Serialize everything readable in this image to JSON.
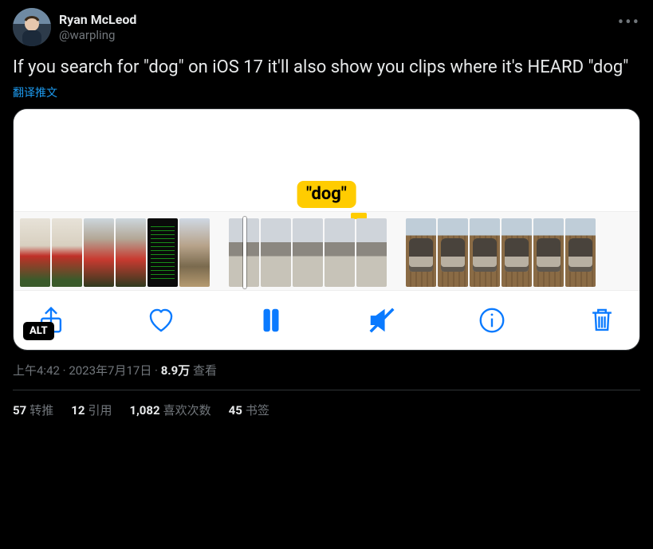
{
  "author": {
    "display_name": "Ryan McLeod",
    "handle": "@warpling"
  },
  "more_icon_label": "more",
  "tweet_text": "If you search for \"dog\" on iOS 17 it'll also show you clips where it's HEARD \"dog\"",
  "translate_label": "翻译推文",
  "media": {
    "bubble_text": "\"dog\"",
    "alt_badge": "ALT",
    "toolbar": {
      "share": "share",
      "like": "like",
      "pause": "pause",
      "mute": "mute",
      "info": "info",
      "delete": "delete"
    }
  },
  "meta": {
    "time": "上午4:42",
    "sep": " · ",
    "date": "2023年7月17日",
    "views_number": "8.9万",
    "views_label": " 查看"
  },
  "stats": {
    "retweets_num": "57",
    "retweets_label": "转推",
    "quotes_num": "12",
    "quotes_label": "引用",
    "likes_num": "1,082",
    "likes_label": "喜欢次数",
    "bookmarks_num": "45",
    "bookmarks_label": "书签"
  }
}
